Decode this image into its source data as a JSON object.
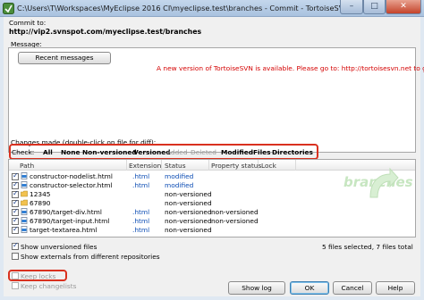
{
  "window": {
    "title": "C:\\Users\\T\\Workspaces\\MyEclipse 2016 CI\\myeclipse.test\\branches - Commit - TortoiseSVN"
  },
  "commit_to": {
    "label": "Commit to:",
    "url": "http://vip2.svnspot.com/myeclipse.test/branches"
  },
  "message": {
    "label": "Message:",
    "recent_button": "Recent messages",
    "update_notice": "A new version of TortoiseSVN is available. Please go to: http://tortoisesvn.net to get it."
  },
  "changes": {
    "label": "Changes made (double-click on file for diff):",
    "check_label": "Check:",
    "filters": [
      {
        "label": "All",
        "enabled": true
      },
      {
        "label": "None",
        "enabled": true
      },
      {
        "label": "Non-versioned",
        "enabled": true
      },
      {
        "label": "Versioned",
        "enabled": true
      },
      {
        "label": "Added",
        "enabled": false
      },
      {
        "label": "Deleted",
        "enabled": false
      },
      {
        "label": "Modified",
        "enabled": true
      },
      {
        "label": "Files",
        "enabled": true
      },
      {
        "label": "Directories",
        "enabled": true
      }
    ],
    "columns": [
      "Path",
      "Extension",
      "Status",
      "Property status",
      "Lock"
    ],
    "rows": [
      {
        "path": "constructor-nodelist.html",
        "ext": ".html",
        "status": "modified",
        "prop": "",
        "checked": true,
        "icon": "html-file-icon"
      },
      {
        "path": "constructor-selector.html",
        "ext": ".html",
        "status": "modified",
        "prop": "",
        "checked": true,
        "icon": "html-file-icon"
      },
      {
        "path": "12345",
        "ext": "",
        "status": "non-versioned",
        "prop": "",
        "checked": true,
        "icon": "folder-icon"
      },
      {
        "path": "67890",
        "ext": "",
        "status": "non-versioned",
        "prop": "",
        "checked": true,
        "icon": "folder-icon"
      },
      {
        "path": "67890/target-div.html",
        "ext": ".html",
        "status": "non-versioned",
        "prop": "non-versioned",
        "checked": true,
        "icon": "html-file-icon"
      },
      {
        "path": "67890/target-input.html",
        "ext": ".html",
        "status": "non-versioned",
        "prop": "non-versioned",
        "checked": true,
        "icon": "html-file-icon"
      },
      {
        "path": "target-textarea.html",
        "ext": ".html",
        "status": "non-versioned",
        "prop": "",
        "checked": true,
        "icon": "html-file-icon"
      }
    ],
    "watermark": "branches"
  },
  "options": {
    "show_unversioned": "Show unversioned files",
    "show_externals": "Show externals from different repositories",
    "summary": "5 files selected, 7 files total",
    "keep_locks": "Keep locks",
    "keep_changelists": "Keep changelists"
  },
  "buttons": {
    "show_log": "Show log",
    "ok": "OK",
    "cancel": "Cancel",
    "help": "Help"
  },
  "colors": {
    "highlight_box": "#d9311f",
    "modified": "#0a4bb3",
    "notice": "#d40000"
  }
}
